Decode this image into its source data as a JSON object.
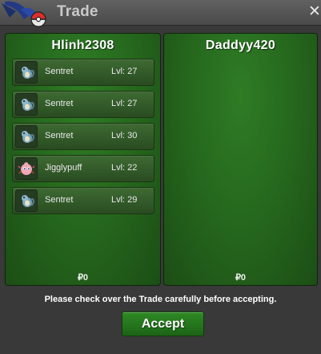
{
  "window": {
    "title": "Trade",
    "close_label": "✕"
  },
  "colors": {
    "panel_green": "#26691e",
    "accept_green": "#237a1c"
  },
  "left_panel": {
    "player": "Hlinh2308",
    "money": "₽0",
    "pokemon": [
      {
        "name": "Sentret",
        "level": "Lvl: 27",
        "icon": "sentret-icon"
      },
      {
        "name": "Sentret",
        "level": "Lvl: 27",
        "icon": "sentret-icon"
      },
      {
        "name": "Sentret",
        "level": "Lvl: 30",
        "icon": "sentret-icon"
      },
      {
        "name": "Jigglypuff",
        "level": "Lvl: 22",
        "icon": "jigglypuff-icon"
      },
      {
        "name": "Sentret",
        "level": "Lvl: 29",
        "icon": "sentret-icon"
      }
    ]
  },
  "right_panel": {
    "player": "Daddyy420",
    "money": "₽0",
    "pokemon": []
  },
  "footer": {
    "notice": "Please check over the Trade carefully before accepting.",
    "accept_label": "Accept"
  }
}
